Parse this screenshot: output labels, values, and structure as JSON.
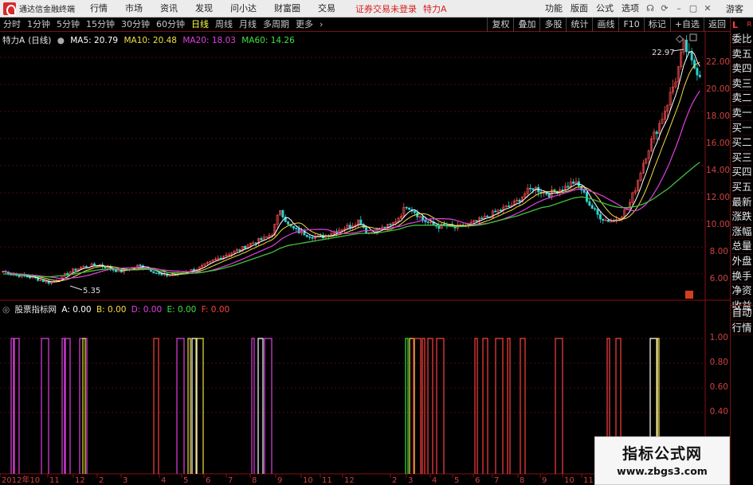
{
  "menubar": {
    "app_title": "通达信金融终端",
    "items": [
      "行情",
      "市场",
      "资讯",
      "发现",
      "问小达",
      "财富圈",
      "交易"
    ],
    "login_status": "证券交易未登录",
    "stock": "特力A",
    "right_items": [
      "功能",
      "版面",
      "公式",
      "选项"
    ],
    "guest": "游客"
  },
  "toolbar": {
    "periods": [
      "分时",
      "1分钟",
      "5分钟",
      "15分钟",
      "30分钟",
      "60分钟",
      "日线",
      "周线",
      "月线",
      "多周期",
      "更多"
    ],
    "active_period": "日线",
    "right_buttons": [
      "复权",
      "叠加",
      "多股",
      "统计",
      "画线",
      "F10",
      "标记",
      "+自选",
      "返回"
    ]
  },
  "main_chart": {
    "stock_label": "特力A",
    "period_label": "(日线)",
    "ma": [
      {
        "label": "MA5: 20.79",
        "color": "#ffffff"
      },
      {
        "label": "MA10: 20.48",
        "color": "#f0e040"
      },
      {
        "label": "MA20: 18.03",
        "color": "#e040e0"
      },
      {
        "label": "MA60: 14.26",
        "color": "#40e040"
      }
    ],
    "y_ticks": [
      "22.00",
      "20.00",
      "18.00",
      "16.00",
      "14.00",
      "12.00",
      "10.00",
      "8.00",
      "6.00"
    ],
    "high_annotation": "22.97",
    "low_annotation": "5.35"
  },
  "sub_chart": {
    "title": "股票指标网",
    "series": [
      {
        "label": "A: 0.00",
        "color": "#ffffff"
      },
      {
        "label": "B: 0.00",
        "color": "#f0e040"
      },
      {
        "label": "D: 0.00",
        "color": "#e040e0"
      },
      {
        "label": "E: 0.00",
        "color": "#40e040"
      },
      {
        "label": "F: 0.00",
        "color": "#ff4040"
      }
    ],
    "y_ticks": [
      "1.00",
      "0.80",
      "0.60",
      "0.40"
    ]
  },
  "x_axis": {
    "labels": [
      "2012年10",
      "11",
      "12",
      "2",
      "3",
      "4",
      "5",
      "6",
      "7",
      "8",
      "9",
      "10",
      "11",
      "12",
      "2",
      "3",
      "4",
      "5",
      "6",
      "7",
      "8",
      "9",
      "10",
      "11"
    ]
  },
  "right_panel": {
    "header_l": "L",
    "header_r": "R",
    "items": [
      "委比",
      "卖五",
      "卖四",
      "卖三",
      "卖二",
      "卖一",
      "买一",
      "买二",
      "买三",
      "买四",
      "买五",
      "最新",
      "涨跌",
      "涨幅",
      "总量",
      "外盘",
      "换手",
      "净资",
      "收益"
    ],
    "bottom_items": [
      "自动",
      "行情"
    ]
  },
  "watermark": {
    "title": "指标公式网",
    "url": "www.zbgs3.com"
  },
  "chart_data": {
    "type": "line",
    "title": "",
    "ylim": [
      5,
      23.5
    ],
    "y_ticks": [
      6,
      8,
      10,
      12,
      14,
      16,
      18,
      20,
      22
    ],
    "high": 22.97,
    "low": 5.35,
    "price_path": [
      6.2,
      6.0,
      5.9,
      5.8,
      5.7,
      5.5,
      5.35,
      5.6,
      6.0,
      6.3,
      6.5,
      6.6,
      6.7,
      6.5,
      6.3,
      6.2,
      6.4,
      6.6,
      6.5,
      6.2,
      5.9,
      5.9,
      6.0,
      6.2,
      6.3,
      6.5,
      6.8,
      7.1,
      7.4,
      7.6,
      7.8,
      8.2,
      8.4,
      8.6,
      9.0,
      10.8,
      9.6,
      9.2,
      9.0,
      8.8,
      8.7,
      8.9,
      9.2,
      9.4,
      9.6,
      10.0,
      9.0,
      9.2,
      9.4,
      9.6,
      10.2,
      11.1,
      10.6,
      10.0,
      9.7,
      9.5,
      9.6,
      9.4,
      9.5,
      9.7,
      9.9,
      10.2,
      10.5,
      10.8,
      11.0,
      11.4,
      12.0,
      12.4,
      12.1,
      11.9,
      12.2,
      12.4,
      12.8,
      12.3,
      11.2,
      10.4,
      10.0,
      9.9,
      10.3,
      11.0,
      12.6,
      14.5,
      16.0,
      17.2,
      18.8,
      20.5,
      22.97,
      21.5,
      20.8
    ],
    "ma60_path": [
      6.0,
      6.0,
      5.95,
      5.9,
      5.85,
      5.8,
      5.8,
      5.85,
      5.9,
      6.0,
      6.1,
      6.2,
      6.3,
      6.35,
      6.35,
      6.3,
      6.3,
      6.3,
      6.35,
      6.3,
      6.2,
      6.1,
      6.1,
      6.05,
      6.05,
      6.1,
      6.2,
      6.3,
      6.45,
      6.6,
      6.8,
      7.0,
      7.2,
      7.4,
      7.6,
      7.9,
      8.1,
      8.2,
      8.3,
      8.4,
      8.5,
      8.6,
      8.7,
      8.8,
      8.9,
      9.0,
      9.0,
      9.0,
      9.1,
      9.2,
      9.3,
      9.5,
      9.6,
      9.6,
      9.6,
      9.6,
      9.55,
      9.5,
      9.5,
      9.55,
      9.6,
      9.7,
      9.85,
      10.0,
      10.15,
      10.3,
      10.5,
      10.7,
      10.9,
      11.0,
      11.2,
      11.4,
      11.6,
      11.7,
      11.6,
      11.4,
      11.2,
      11.0,
      10.9,
      10.9,
      11.0,
      11.2,
      11.5,
      11.9,
      12.3,
      12.8,
      13.3,
      13.8,
      14.26
    ]
  }
}
